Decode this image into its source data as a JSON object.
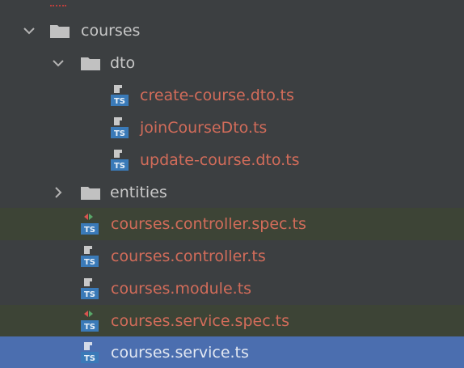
{
  "tree": {
    "items": [
      {
        "label": "courses",
        "type": "folder",
        "expanded": true
      },
      {
        "label": "dto",
        "type": "folder",
        "expanded": true
      },
      {
        "label": "create-course.dto.ts",
        "type": "ts-file"
      },
      {
        "label": "joinCourseDto.ts",
        "type": "ts-file"
      },
      {
        "label": "update-course.dto.ts",
        "type": "ts-file"
      },
      {
        "label": "entities",
        "type": "folder",
        "expanded": false
      },
      {
        "label": "courses.controller.spec.ts",
        "type": "ts-test-file"
      },
      {
        "label": "courses.controller.ts",
        "type": "ts-file"
      },
      {
        "label": "courses.module.ts",
        "type": "ts-file"
      },
      {
        "label": "courses.service.spec.ts",
        "type": "ts-test-file"
      },
      {
        "label": "courses.service.ts",
        "type": "ts-file",
        "selected": true
      }
    ]
  },
  "colors": {
    "background": "#3c3f41",
    "selected_row": "#4b6eaf",
    "test_row": "#3d4436",
    "folder_text": "#c8c8c8",
    "modified_file_text": "#d26c5a",
    "selected_text": "#e3e8f2",
    "ts_badge": "#3a7ab8"
  },
  "icons": {
    "expanded": "chevron-down-icon",
    "collapsed": "chevron-right-icon",
    "folder": "folder-icon",
    "ts_file": "typescript-file-icon",
    "ts_test_file": "typescript-test-file-icon"
  }
}
